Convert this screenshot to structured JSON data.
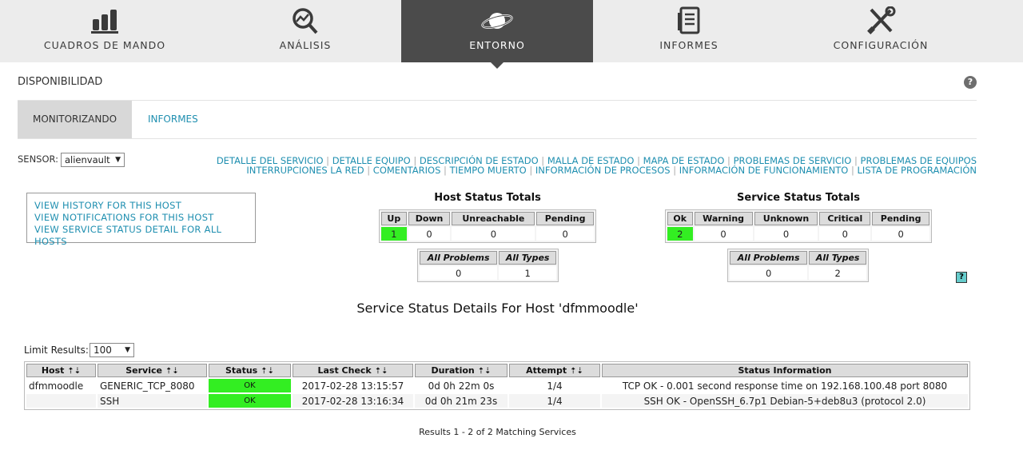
{
  "nav": {
    "tabs": [
      {
        "label": "CUADROS DE MANDO",
        "icon": "bar-chart-icon"
      },
      {
        "label": "ANÁLISIS",
        "icon": "magnifier-icon"
      },
      {
        "label": "ENTORNO",
        "icon": "planet-icon",
        "active": true
      },
      {
        "label": "INFORMES",
        "icon": "document-icon"
      },
      {
        "label": "CONFIGURACIÓN",
        "icon": "tools-icon"
      }
    ]
  },
  "section": {
    "title": "DISPONIBILIDAD",
    "help": "?"
  },
  "subtabs": {
    "monitor": "MONITORIZANDO",
    "reports": "INFORMES"
  },
  "sensor": {
    "label": "SENSOR:",
    "value": "alienvault"
  },
  "links": {
    "row1": [
      "DETALLE DEL SERVICIO",
      "DETALLE EQUIPO",
      "DESCRIPCIÓN DE ESTADO",
      "MALLA DE ESTADO",
      "MAPA DE ESTADO",
      "PROBLEMAS DE SERVICIO",
      "PROBLEMAS DE EQUIPOS"
    ],
    "row2": [
      "INTERRUPCIONES LA RED",
      "COMENTARIOS",
      "TIEMPO MUERTO",
      "INFORMACIÓN DE PROCESOS",
      "INFORMACIÓN DE FUNCIONAMIENTO",
      "LISTA DE PROGRAMACIÓN"
    ]
  },
  "host_links": {
    "history": "VIEW HISTORY FOR THIS HOST",
    "notifications": "VIEW NOTIFICATIONS FOR THIS HOST",
    "service_detail": "VIEW SERVICE STATUS DETAIL FOR ALL HOSTS"
  },
  "host_totals": {
    "title": "Host Status Totals",
    "headers": {
      "up": "Up",
      "down": "Down",
      "unreachable": "Unreachable",
      "pending": "Pending"
    },
    "values": {
      "up": "1",
      "down": "0",
      "unreachable": "0",
      "pending": "0"
    },
    "all_headers": {
      "problems": "All Problems",
      "types": "All Types"
    },
    "all_values": {
      "problems": "0",
      "types": "1"
    }
  },
  "service_totals": {
    "title": "Service Status Totals",
    "headers": {
      "ok": "Ok",
      "warning": "Warning",
      "unknown": "Unknown",
      "critical": "Critical",
      "pending": "Pending"
    },
    "values": {
      "ok": "2",
      "warning": "0",
      "unknown": "0",
      "critical": "0",
      "pending": "0"
    },
    "all_headers": {
      "problems": "All Problems",
      "types": "All Types"
    },
    "all_values": {
      "problems": "0",
      "types": "2"
    }
  },
  "qmark": "?",
  "details": {
    "title": "Service Status Details For Host 'dfmmoodle'",
    "limit_label": "Limit Results:",
    "limit_value": "100",
    "columns": {
      "host": "Host",
      "service": "Service",
      "status": "Status",
      "last_check": "Last Check",
      "duration": "Duration",
      "attempt": "Attempt",
      "info": "Status Information"
    },
    "rows": [
      {
        "host": "dfmmoodle",
        "service": "GENERIC_TCP_8080",
        "status": "OK",
        "last_check": "2017-02-28 13:15:57",
        "duration": "0d 0h 22m 0s",
        "attempt": "1/4",
        "info": "TCP OK - 0.001 second response time on 192.168.100.48 port 8080"
      },
      {
        "host": "",
        "service": "SSH",
        "status": "OK",
        "last_check": "2017-02-28 13:16:34",
        "duration": "0d 0h 21m 23s",
        "attempt": "1/4",
        "info": "SSH OK - OpenSSH_6.7p1 Debian-5+deb8u3 (protocol 2.0)"
      }
    ],
    "results": "Results 1 - 2 of 2 Matching Services"
  },
  "colors": {
    "accent_link": "#1f8fb0",
    "ok_green": "#33ee22",
    "nav_active": "#4b4b4b"
  }
}
